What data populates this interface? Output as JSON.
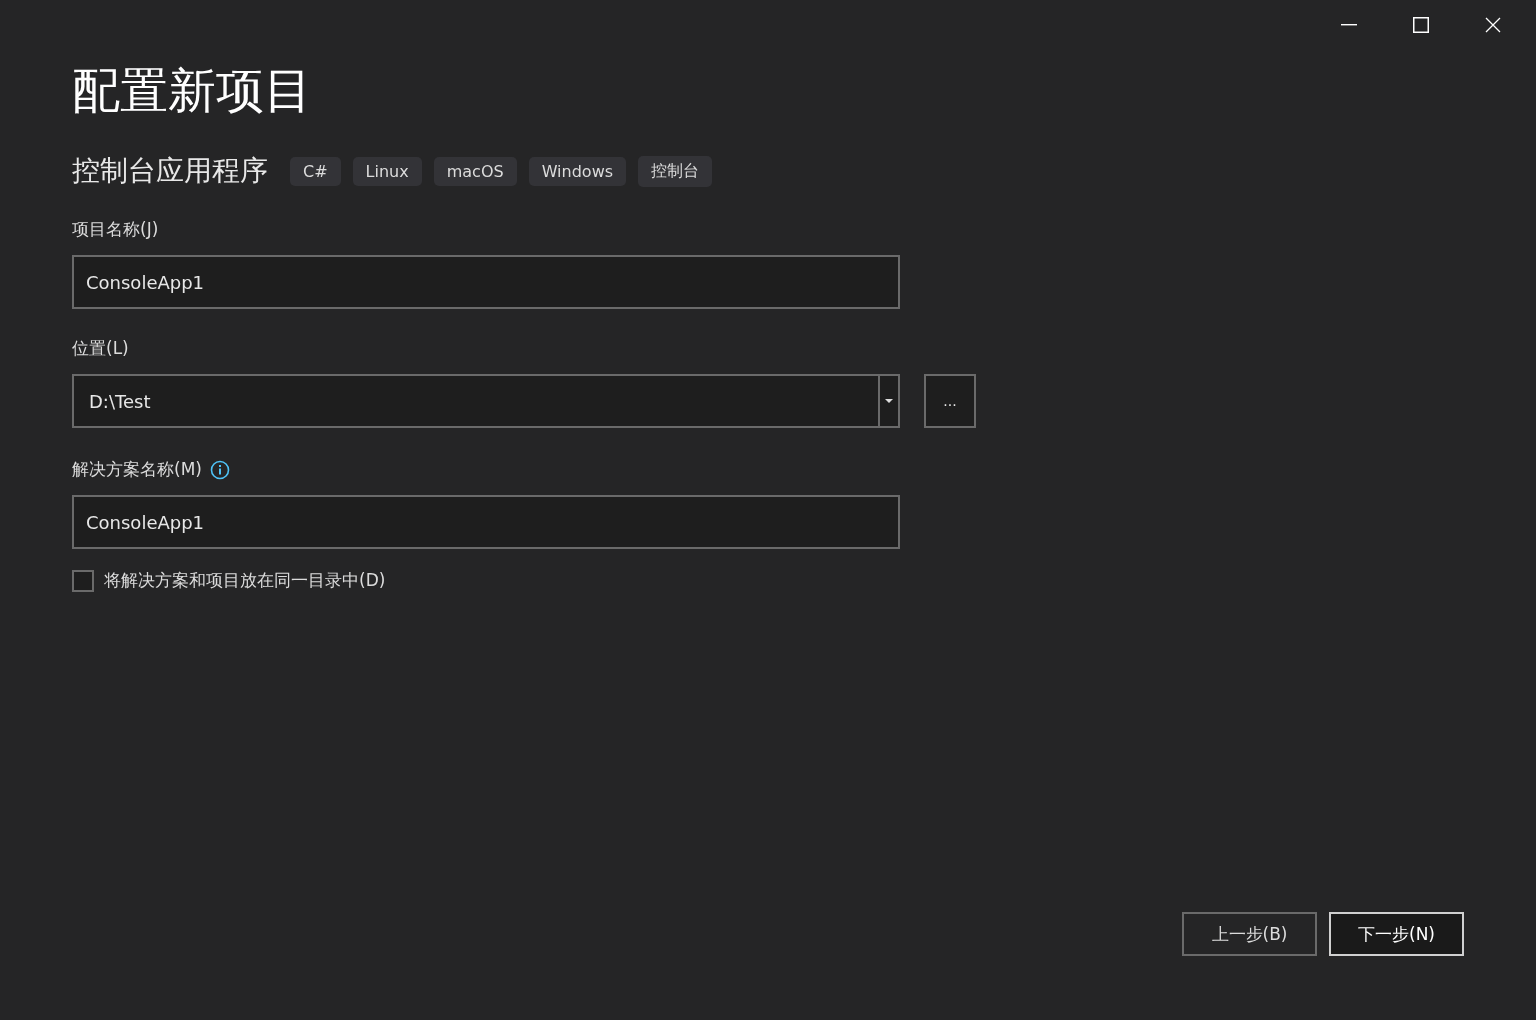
{
  "title": "配置新项目",
  "template": {
    "name": "控制台应用程序",
    "tags": [
      "C#",
      "Linux",
      "macOS",
      "Windows",
      "控制台"
    ]
  },
  "project_name": {
    "label": "项目名称(J)",
    "value": "ConsoleApp1"
  },
  "location": {
    "label": "位置(L)",
    "value": "D:\\Test",
    "browse": "..."
  },
  "solution_name": {
    "label": "解决方案名称(M)",
    "value": "ConsoleApp1"
  },
  "same_directory": {
    "label": "将解决方案和项目放在同一目录中(D)",
    "checked": false
  },
  "buttons": [
    {
      "label": "上一步(B)",
      "kind": "secondary"
    },
    {
      "label": "下一步(N)",
      "kind": "primary"
    }
  ]
}
